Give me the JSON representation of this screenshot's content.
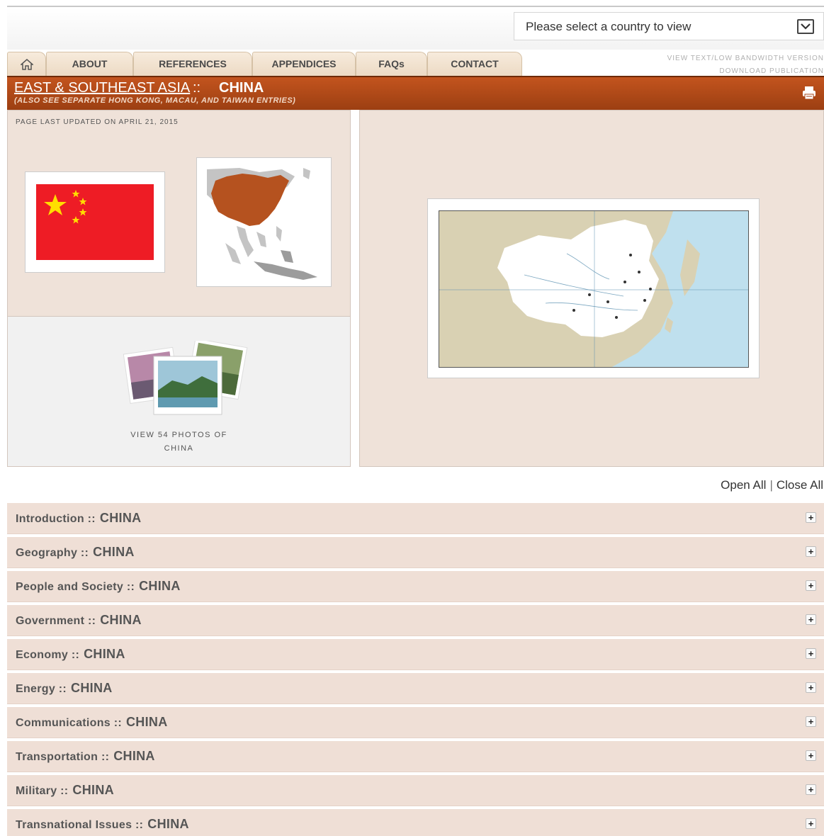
{
  "country_selector": {
    "placeholder": "Please select a country to view"
  },
  "nav": {
    "tabs": [
      {
        "label": "ABOUT"
      },
      {
        "label": "REFERENCES"
      },
      {
        "label": "APPENDICES"
      },
      {
        "label": "FAQs"
      },
      {
        "label": "CONTACT"
      }
    ],
    "right_links": [
      "VIEW TEXT/LOW BANDWIDTH VERSION",
      "DOWNLOAD PUBLICATION"
    ]
  },
  "header": {
    "region": "EAST & SOUTHEAST ASIA",
    "separator": "::",
    "country": "CHINA",
    "note": "(ALSO SEE SEPARATE HONG KONG, MACAU, AND TAIWAN ENTRIES)"
  },
  "left_panel": {
    "updated": "PAGE LAST UPDATED ON APRIL 21, 2015",
    "photos_line1": "VIEW 54 PHOTOS OF",
    "photos_line2": "CHINA"
  },
  "controls": {
    "open_all": "Open All",
    "divider": "|",
    "close_all": "Close All"
  },
  "sections": [
    {
      "label": "Introduction ::",
      "country": "CHINA"
    },
    {
      "label": "Geography ::",
      "country": "CHINA"
    },
    {
      "label": "People and Society ::",
      "country": "CHINA"
    },
    {
      "label": "Government ::",
      "country": "CHINA"
    },
    {
      "label": "Economy ::",
      "country": "CHINA"
    },
    {
      "label": "Energy ::",
      "country": "CHINA"
    },
    {
      "label": "Communications ::",
      "country": "CHINA"
    },
    {
      "label": "Transportation ::",
      "country": "CHINA"
    },
    {
      "label": "Military ::",
      "country": "CHINA"
    },
    {
      "label": "Transnational Issues ::",
      "country": "CHINA"
    }
  ],
  "expand_symbol": "+",
  "colors": {
    "header_orange": "#b04a18",
    "panel_bg": "#efe2d9",
    "section_bg": "#efdfd6",
    "flag_red": "#ee1c25",
    "flag_star": "#ffde00",
    "china_highlight": "#b5521f"
  }
}
